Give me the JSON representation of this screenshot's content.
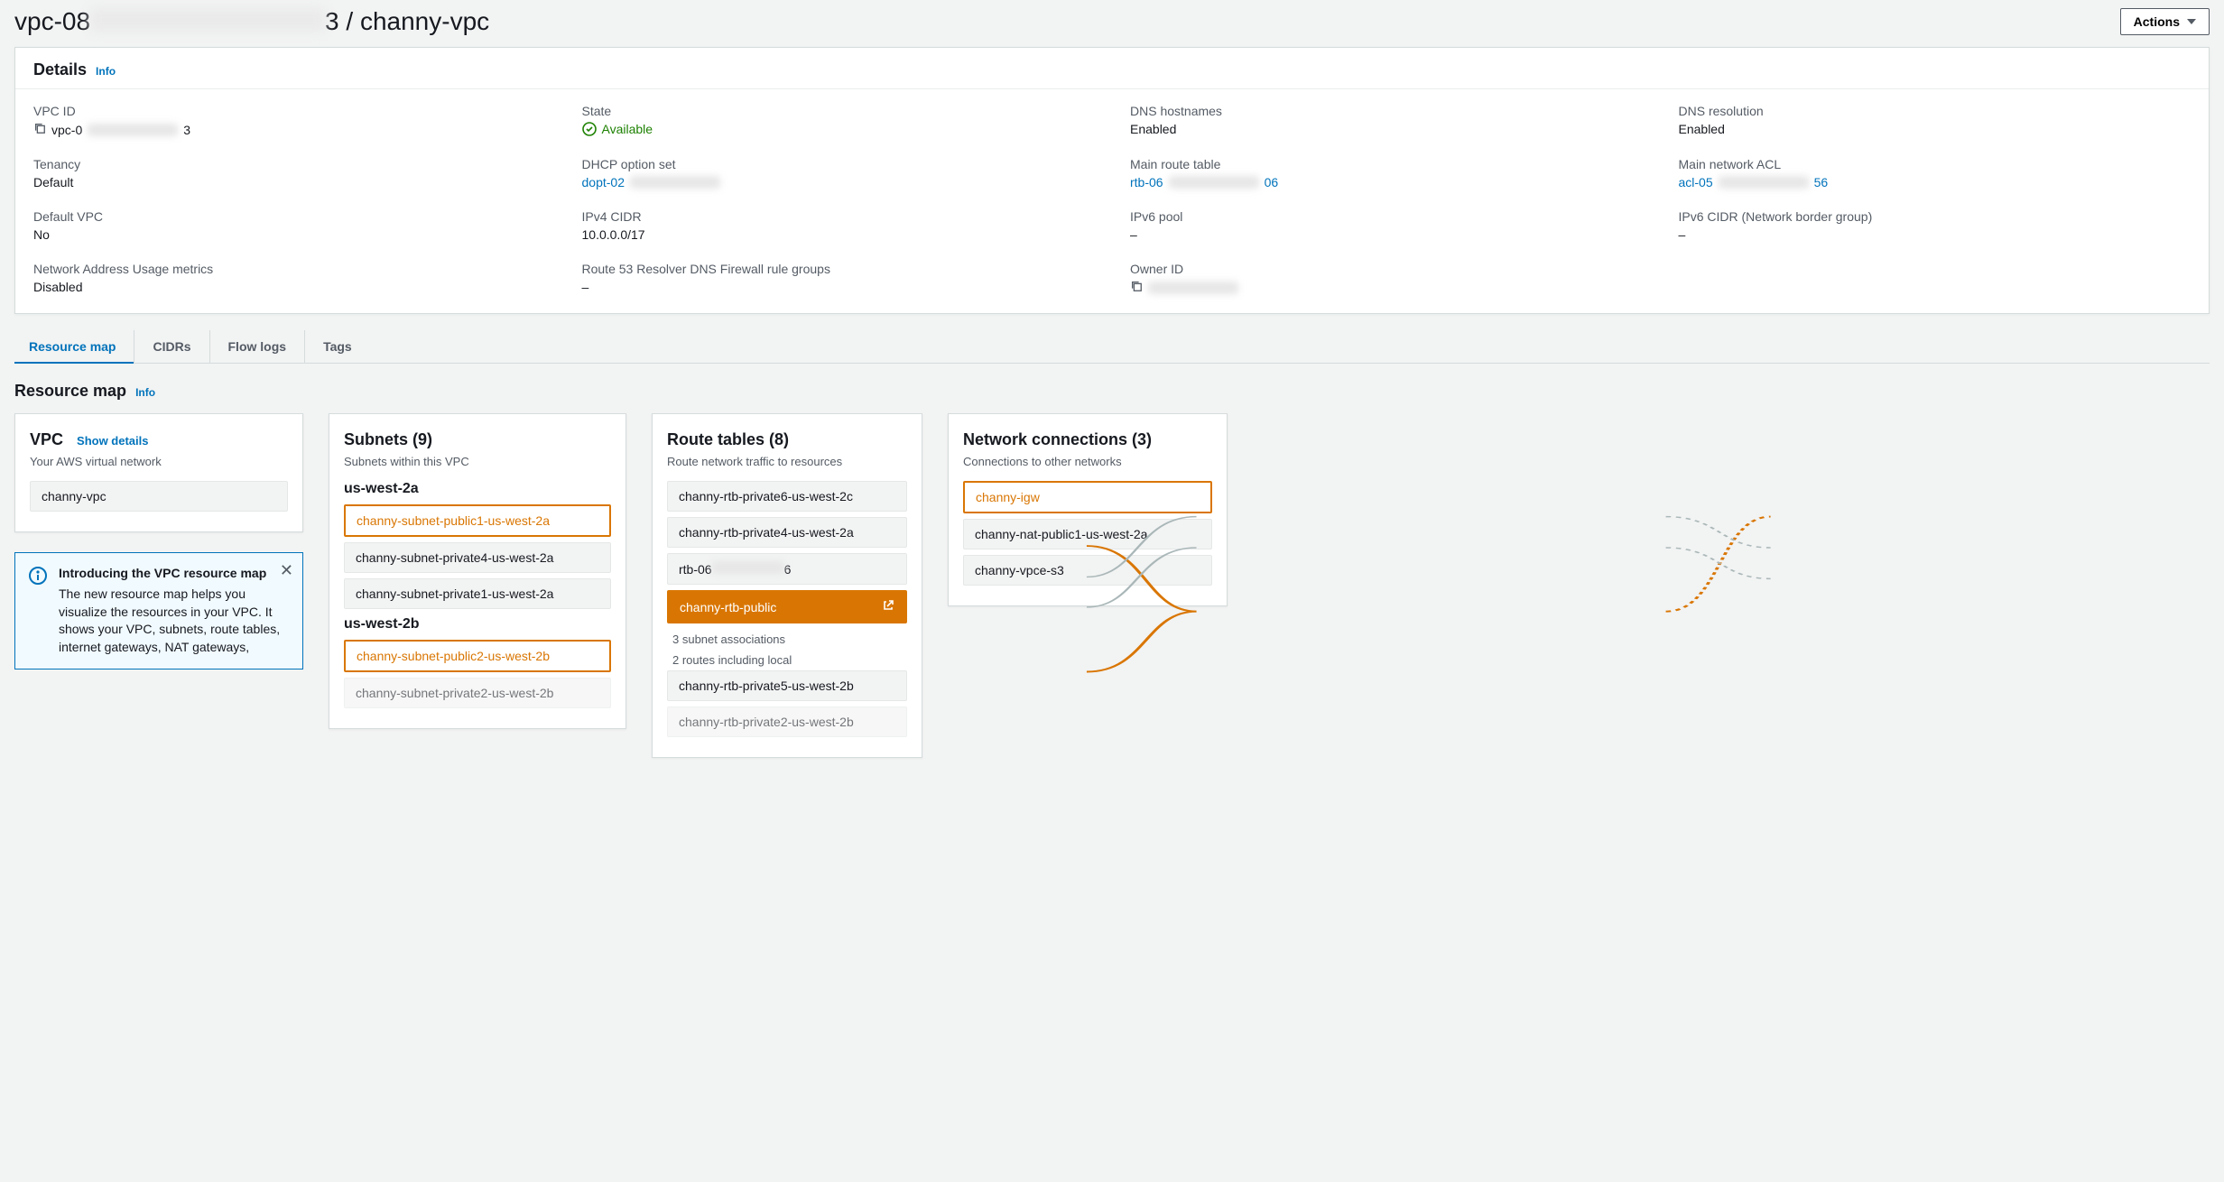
{
  "header": {
    "title_prefix": "vpc-08",
    "title_suffix": "3 / channy-vpc",
    "actions_label": "Actions"
  },
  "details": {
    "panel_title": "Details",
    "info_label": "Info",
    "items": {
      "vpc_id_label": "VPC ID",
      "vpc_id_prefix": "vpc-0",
      "vpc_id_suffix": "3",
      "state_label": "State",
      "state_value": "Available",
      "dns_hostnames_label": "DNS hostnames",
      "dns_hostnames_value": "Enabled",
      "dns_resolution_label": "DNS resolution",
      "dns_resolution_value": "Enabled",
      "tenancy_label": "Tenancy",
      "tenancy_value": "Default",
      "dhcp_label": "DHCP option set",
      "dhcp_prefix": "dopt-02",
      "main_rt_label": "Main route table",
      "main_rt_prefix": "rtb-06",
      "main_rt_suffix": "06",
      "main_acl_label": "Main network ACL",
      "main_acl_prefix": "acl-05",
      "main_acl_suffix": "56",
      "default_vpc_label": "Default VPC",
      "default_vpc_value": "No",
      "ipv4_cidr_label": "IPv4 CIDR",
      "ipv4_cidr_value": "10.0.0.0/17",
      "ipv6_pool_label": "IPv6 pool",
      "ipv6_pool_value": "–",
      "ipv6_cidr_label": "IPv6 CIDR (Network border group)",
      "ipv6_cidr_value": "–",
      "nau_label": "Network Address Usage metrics",
      "nau_value": "Disabled",
      "r53_label": "Route 53 Resolver DNS Firewall rule groups",
      "r53_value": "–",
      "owner_label": "Owner ID"
    }
  },
  "tabs": {
    "resource_map": "Resource map",
    "cidrs": "CIDRs",
    "flow_logs": "Flow logs",
    "tags": "Tags"
  },
  "resource_map": {
    "title": "Resource map",
    "info_label": "Info",
    "vpc_card": {
      "title": "VPC",
      "show_details": "Show details",
      "subtitle": "Your AWS virtual network",
      "name": "channy-vpc"
    },
    "alert": {
      "title": "Introducing the VPC resource map",
      "body": "The new resource map helps you visualize the resources in your VPC. It shows your VPC, subnets, route tables, internet gateways, NAT gateways,"
    },
    "subnets_card": {
      "title": "Subnets (9)",
      "subtitle": "Subnets within this VPC",
      "az1": "us-west-2a",
      "az1_items": {
        "0": "channy-subnet-public1-us-west-2a",
        "1": "channy-subnet-private4-us-west-2a",
        "2": "channy-subnet-private1-us-west-2a"
      },
      "az2": "us-west-2b",
      "az2_items": {
        "0": "channy-subnet-public2-us-west-2b",
        "1": "channy-subnet-private2-us-west-2b"
      }
    },
    "rt_card": {
      "title": "Route tables (8)",
      "subtitle": "Route network traffic to resources",
      "items": {
        "0": "channy-rtb-private6-us-west-2c",
        "1": "channy-rtb-private4-us-west-2a",
        "2_prefix": "rtb-06",
        "2_suffix": "6",
        "3": "channy-rtb-public",
        "3_sub1": "3 subnet associations",
        "3_sub2": "2 routes including local",
        "4": "channy-rtb-private5-us-west-2b",
        "5": "channy-rtb-private2-us-west-2b"
      }
    },
    "nc_card": {
      "title": "Network connections (3)",
      "subtitle": "Connections to other networks",
      "items": {
        "0": "channy-igw",
        "1": "channy-nat-public1-us-west-2a",
        "2": "channy-vpce-s3"
      }
    }
  }
}
